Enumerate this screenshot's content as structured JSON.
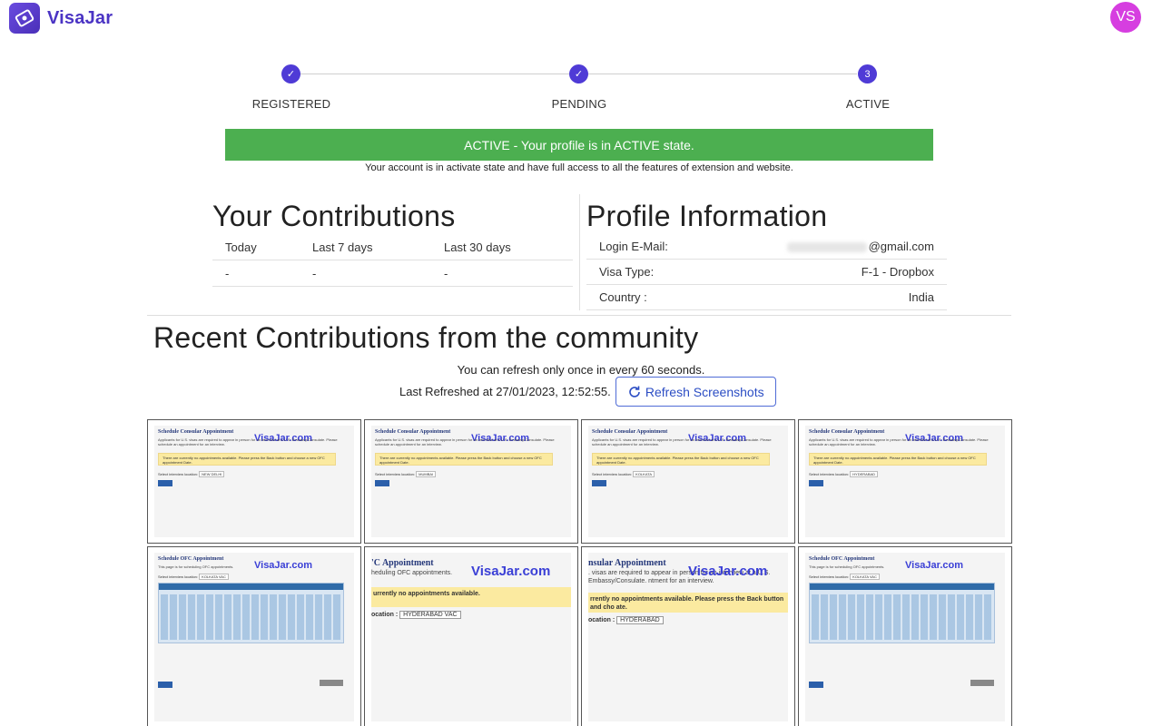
{
  "header": {
    "app_name": "VisaJar",
    "avatar_initials": "VS"
  },
  "stepper": {
    "steps": [
      {
        "label": "REGISTERED",
        "marker": "✓",
        "state": "done"
      },
      {
        "label": "PENDING",
        "marker": "✓",
        "state": "done"
      },
      {
        "label": "ACTIVE",
        "marker": "3",
        "state": "current"
      }
    ]
  },
  "status": {
    "banner": "ACTIVE - Your profile is in ACTIVE state.",
    "subtext": "Your account is in activate state and have full access to all the features of extension and website.",
    "color": "#4caf50"
  },
  "contributions": {
    "title": "Your Contributions",
    "headers": [
      "Today",
      "Last 7 days",
      "Last 30 days"
    ],
    "values": [
      "-",
      "-",
      "-"
    ]
  },
  "profile": {
    "title": "Profile Information",
    "rows": [
      {
        "label": "Login E-Mail:",
        "value": "@gmail.com"
      },
      {
        "label": "Visa Type:",
        "value": "F-1 - Dropbox"
      },
      {
        "label": "Country :",
        "value": "India"
      }
    ]
  },
  "community": {
    "title": "Recent Contributions from the community",
    "refresh_note": "You can refresh only once in every 60 seconds.",
    "last_refreshed": "Last Refreshed at 27/01/2023, 12:52:55.",
    "refresh_button": "Refresh Screenshots"
  },
  "screenshots": {
    "watermark": "VisaJar.com",
    "consular_title": "Schedule Consular Appointment",
    "consular_text": "Applicants for U.S. visas are required to appear in person for an interview at a U.S. Embassy/Consulate. Please schedule an appointment for an interview.",
    "no_appt": "There are currently no appointments available. Please press the Back button and choose a new OFC appointment Date.",
    "location_label": "Select interview location:",
    "ofc_title": "Schedule OFC Appointment",
    "ofc_text": "This page is for scheduling OFC appointments.",
    "row1_locations": [
      "NEW DELHI",
      "MUMBAI",
      "KOLKATA",
      "HYDERABAD"
    ],
    "row2": {
      "cal_location": "KOLKATA VAC",
      "z1_title": "'C Appointment",
      "z1_sub": "heduling OFC appointments.",
      "z1_alert": "urrently no appointments available.",
      "z1_loc_label": "ocation :",
      "z1_loc": "HYDERABAD VAC",
      "z2_title": "nsular Appointment",
      "z2_sub": ". visas are required to appear in person for an interview at a U.S. Embassy/Consulate. ntment for an interview.",
      "z2_alert": "rrently no appointments available. Please press the Back button and cho ate.",
      "z2_loc_label": "ocation :",
      "z2_loc": "HYDERABAD",
      "cal4_location": "KOLKATA VAC"
    }
  }
}
